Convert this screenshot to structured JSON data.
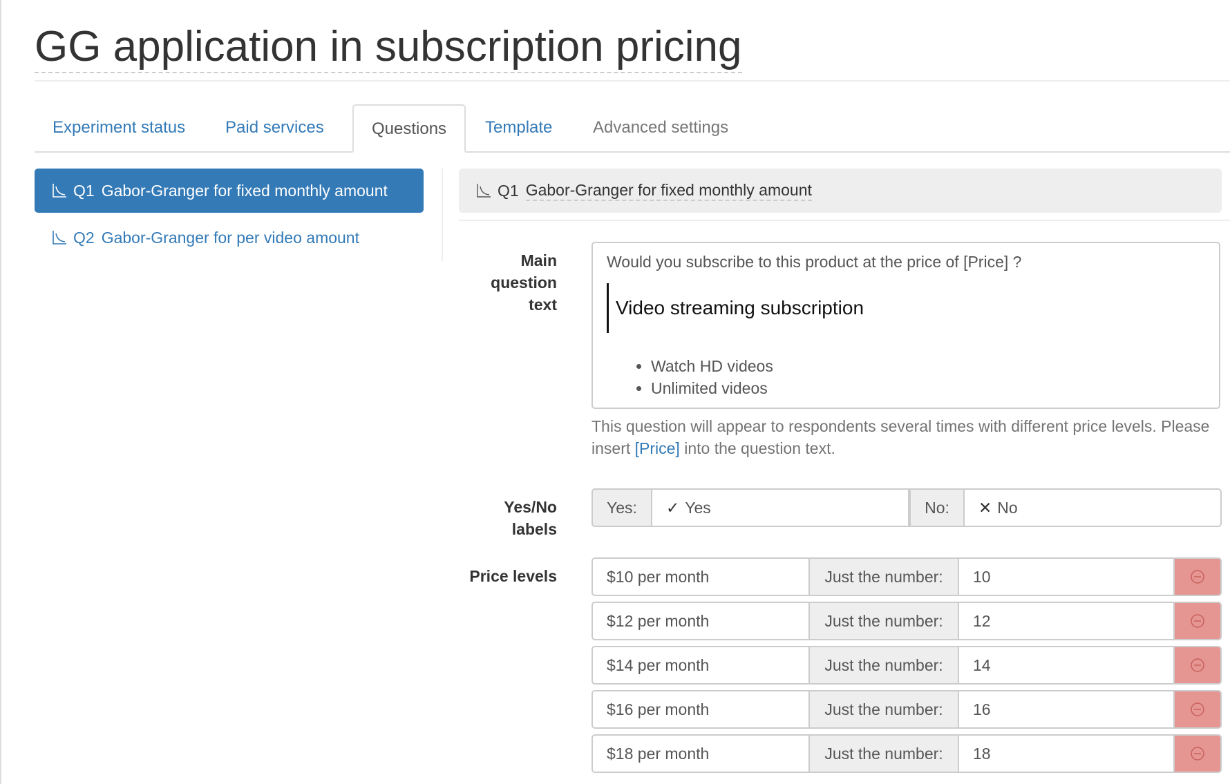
{
  "page": {
    "title": "GG application in subscription pricing"
  },
  "tabs": [
    {
      "label": "Experiment status",
      "state": "link"
    },
    {
      "label": "Paid services",
      "state": "link"
    },
    {
      "label": "Questions",
      "state": "active"
    },
    {
      "label": "Template",
      "state": "link"
    },
    {
      "label": "Advanced settings",
      "state": "muted"
    }
  ],
  "sidebar": {
    "items": [
      {
        "icon": "demand-curve-icon",
        "number": "Q1",
        "label": "Gabor-Granger for fixed monthly amount",
        "active": true
      },
      {
        "icon": "demand-curve-icon",
        "number": "Q2",
        "label": "Gabor-Granger for per video amount",
        "active": false
      }
    ]
  },
  "panel": {
    "number": "Q1",
    "title": "Gabor-Granger for fixed monthly amount",
    "main_question": {
      "label": "Main question text",
      "label_lines": [
        "Main",
        "question",
        "text"
      ],
      "line1": "Would you subscribe to this product at the price of [Price] ?",
      "quote": "Video streaming subscription",
      "bullets": [
        "Watch HD videos",
        "Unlimited videos"
      ]
    },
    "help": {
      "before": "This question will appear to respondents several times with different price levels. Please insert ",
      "token": "[Price]",
      "after": " into the question text."
    },
    "yesno": {
      "label_lines": [
        "Yes/No",
        "labels"
      ],
      "yes_addon": "Yes:",
      "yes_value": "Yes",
      "yes_symbol": "✓",
      "no_addon": "No:",
      "no_value": "No",
      "no_symbol": "✕"
    },
    "price_levels": {
      "label": "Price levels",
      "number_addon": "Just the number:",
      "rows": [
        {
          "text": "$10 per month",
          "number": "10"
        },
        {
          "text": "$12 per month",
          "number": "12"
        },
        {
          "text": "$14 per month",
          "number": "14"
        },
        {
          "text": "$16 per month",
          "number": "16"
        },
        {
          "text": "$18 per month",
          "number": "18"
        }
      ]
    }
  },
  "colors": {
    "brand": "#337ab7",
    "remove": "#e59693"
  }
}
